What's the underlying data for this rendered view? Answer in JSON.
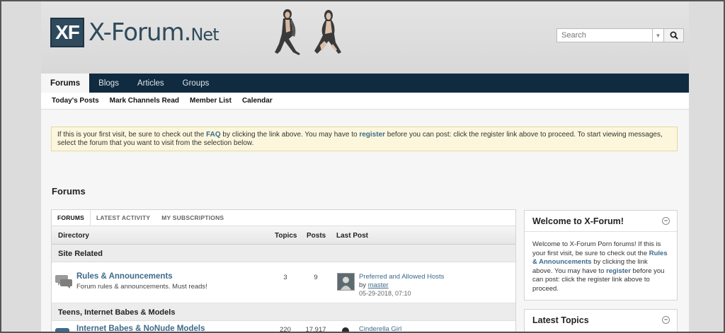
{
  "site": {
    "logo_mark": "XF",
    "logo_name": "X-Forum.",
    "logo_suffix": "Net"
  },
  "search": {
    "placeholder": "Search"
  },
  "nav": {
    "tabs": [
      "Forums",
      "Blogs",
      "Articles",
      "Groups"
    ],
    "active": "Forums"
  },
  "subnav": {
    "items": [
      "Today's Posts",
      "Mark Channels Read",
      "Member List",
      "Calendar"
    ]
  },
  "notice": {
    "t1": "If this is your first visit, be sure to check out the ",
    "faq": "FAQ",
    "t2": " by clicking the link above. You may have to ",
    "register": "register",
    "t3": " before you can post: click the register link above to proceed. To start viewing messages, select the forum that you want to visit from the selection below."
  },
  "main": {
    "title": "Forums",
    "tabs": [
      "FORUMS",
      "LATEST ACTIVITY",
      "MY SUBSCRIPTIONS"
    ],
    "columns": {
      "directory": "Directory",
      "topics": "Topics",
      "posts": "Posts",
      "last_post": "Last Post"
    },
    "categories": [
      {
        "name": "Site Related",
        "forum": {
          "title": "Rules & Announcements",
          "description": "Forum rules & announcements. Must reads!",
          "topics": "3",
          "posts": "9",
          "last_post_title": "Preferred and Allowed Hosts",
          "last_post_by_prefix": "by ",
          "last_post_author": "master",
          "last_post_date": "05-29-2018, 07:10"
        }
      },
      {
        "name": "Teens, Internet Babes & Models",
        "forum": {
          "title": "Internet Babes & NoNude Models",
          "topics": "220",
          "posts": "17,917",
          "last_post_title": "Cinderella Girl"
        }
      }
    ]
  },
  "sidebar": {
    "welcome": {
      "title": "Welcome to X-Forum!",
      "t1": "Welcome to X-Forum Porn forums! If this is your first visit, be sure to check out the ",
      "link": "Rules & Announcements",
      "t2": " by clicking the link above. You may have to ",
      "register": "register",
      "t3": " before you can post: click the register link above to proceed."
    },
    "latest": {
      "title": "Latest Topics"
    },
    "collapse_symbol": "−"
  }
}
